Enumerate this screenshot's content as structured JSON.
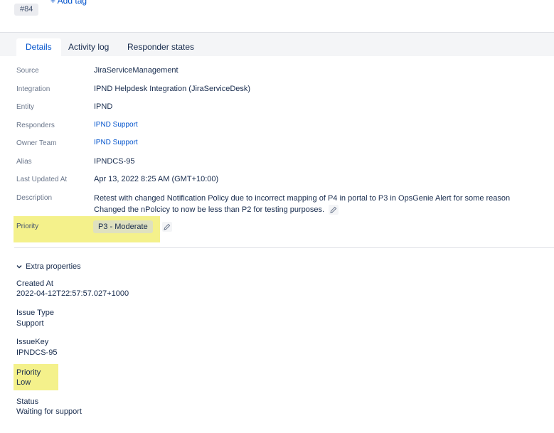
{
  "header": {
    "tag_chip": "#84",
    "add_tag": "+ Add tag"
  },
  "tabs": [
    {
      "label": "Details",
      "active": true
    },
    {
      "label": "Activity log",
      "active": false
    },
    {
      "label": "Responder states",
      "active": false
    }
  ],
  "details": {
    "source": {
      "label": "Source",
      "value": "JiraServiceManagement"
    },
    "integration": {
      "label": "Integration",
      "value": "IPND Helpdesk Integration (JiraServiceDesk)"
    },
    "entity": {
      "label": "Entity",
      "value": "IPND"
    },
    "responders": {
      "label": "Responders",
      "value": "IPND Support"
    },
    "owner_team": {
      "label": "Owner Team",
      "value": "IPND Support"
    },
    "alias": {
      "label": "Alias",
      "value": "IPNDCS-95"
    },
    "last_updated": {
      "label": "Last Updated At",
      "value": "Apr 13, 2022 8:25 AM (GMT+10:00)"
    },
    "description": {
      "label": "Description",
      "line1": "Retest with changed Notification Policy due to incorrect mapping of P4 in portal to P3 in OpsGenie Alert for some reason",
      "line2": "Changed the nPolcicy to now be less than P2 for testing purposes."
    },
    "priority": {
      "label": "Priority",
      "value": "P3 - Moderate"
    }
  },
  "extra": {
    "toggle_label": "Extra properties",
    "properties": [
      {
        "label": "Created At",
        "value": "2022-04-12T22:57:57.027+1000"
      },
      {
        "label": "Issue Type",
        "value": "Support"
      },
      {
        "label": "IssueKey",
        "value": "IPNDCS-95"
      },
      {
        "label": "Priority",
        "value": "Low"
      },
      {
        "label": "Status",
        "value": "Waiting for support"
      }
    ]
  },
  "colors": {
    "highlight": "#f4f18b",
    "link": "#0052cc"
  }
}
